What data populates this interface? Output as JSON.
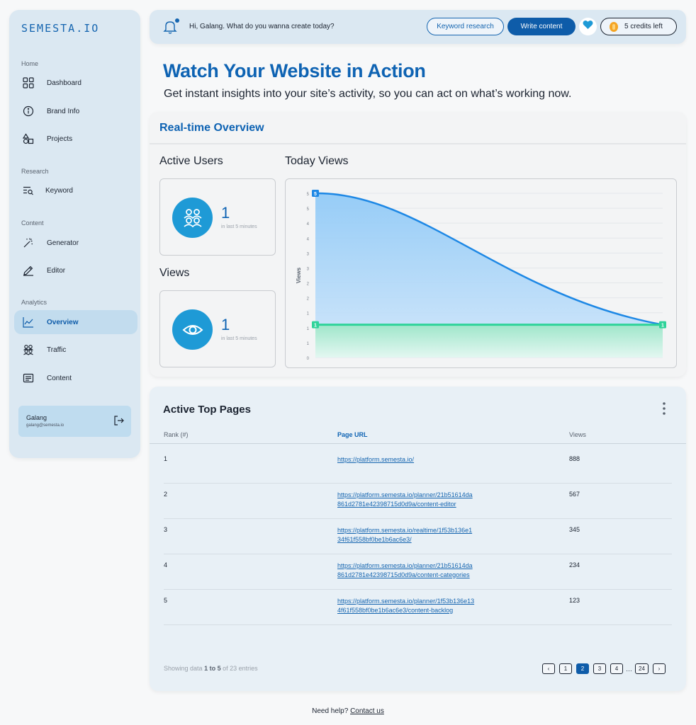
{
  "app": {
    "logo": "SEMESTA.IO"
  },
  "sidebar": {
    "sections": [
      "Home",
      "Research",
      "Content",
      "Analytics"
    ],
    "items": [
      {
        "label": "Dashboard",
        "icon": "grid-icon"
      },
      {
        "label": "Brand Info",
        "icon": "info-icon"
      },
      {
        "label": "Projects",
        "icon": "shapes-icon"
      },
      {
        "label": "Keyword",
        "icon": "list-search-icon"
      },
      {
        "label": "Generator",
        "icon": "magic-wand-icon"
      },
      {
        "label": "Editor",
        "icon": "pencil-icon"
      },
      {
        "label": "Overview",
        "icon": "chart-line-icon",
        "active": true
      },
      {
        "label": "Traffic",
        "icon": "users-icon"
      },
      {
        "label": "Content",
        "icon": "document-icon"
      }
    ],
    "user": {
      "name": "Galang",
      "email": "galang@semesta.io"
    }
  },
  "topbar": {
    "greeting": "Hi, Galang. What do you wanna create today?",
    "keyword_btn": "Keyword research",
    "write_btn": "Write content",
    "credits": "5 credits left"
  },
  "header": {
    "title": "Watch Your Website in Action",
    "subtitle": "Get instant insights into your site’s activity, so you can act on what’s working now."
  },
  "realtime": {
    "title": "Real-time Overview",
    "active_users": {
      "label": "Active Users",
      "value": "1",
      "caption": "in last 5 minutes"
    },
    "views": {
      "label": "Views",
      "value": "1",
      "caption": "in last 5 minutes"
    },
    "today_views_label": "Today Views"
  },
  "chart_data": {
    "type": "area",
    "ylabel": "Views",
    "ylim": [
      0,
      5
    ],
    "y_ticks": [
      "5",
      "5",
      "4",
      "4",
      "3",
      "3",
      "2",
      "2",
      "1",
      "1",
      "1",
      "0"
    ],
    "series": [
      {
        "values": [
          5,
          1
        ],
        "color": "#1e88e5"
      },
      {
        "values": [
          1,
          1
        ],
        "color": "#2fd39a"
      }
    ],
    "point_labels": [
      "5",
      "1",
      "1"
    ]
  },
  "pages": {
    "title": "Active Top Pages",
    "columns": [
      "Rank (#)",
      "Page URL",
      "Views"
    ],
    "rows": [
      {
        "rank": "1",
        "url": "https://platform.semesta.io/",
        "views": "888"
      },
      {
        "rank": "2",
        "url": "https://platform.semesta.io/planner/21b51614da861d2781e42398715d0d9a/content-editor",
        "views": "567"
      },
      {
        "rank": "3",
        "url": "https://platform.semesta.io/realtime/1f53b136e134f61f558bf0be1b6ac6e3/",
        "views": "345"
      },
      {
        "rank": "4",
        "url": "https://platform.semesta.io/planner/21b51614da861d2781e42398715d0d9a/content-categories",
        "views": "234"
      },
      {
        "rank": "5",
        "url": "https://platform.semesta.io/planner/1f53b136e134f61f558bf0be1b6ac6e3/content-backlog",
        "views": "123"
      }
    ],
    "showing": {
      "prefix": "Showing data",
      "range": "1 to 5",
      "of": "of",
      "total": "23 entries"
    },
    "pagination": [
      "‹",
      "1",
      "2",
      "3",
      "4",
      "…",
      "24",
      "›"
    ],
    "current_page": "2"
  },
  "footer": {
    "text": "Need help?",
    "link": "Contact us"
  }
}
